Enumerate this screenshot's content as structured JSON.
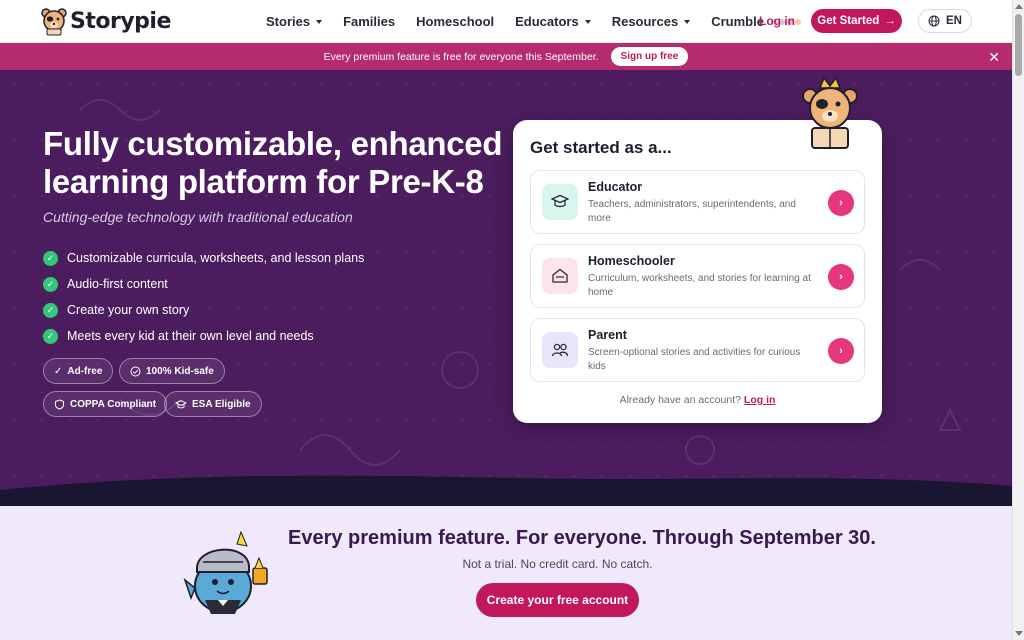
{
  "header": {
    "logo_text": "Storypie",
    "nav": [
      {
        "label": "Stories",
        "dropdown": true
      },
      {
        "label": "Families",
        "dropdown": false
      },
      {
        "label": "Homeschool",
        "dropdown": false
      },
      {
        "label": "Educators",
        "dropdown": true
      },
      {
        "label": "Resources",
        "dropdown": true
      },
      {
        "label": "Crumble",
        "dropdown": false
      }
    ],
    "login_label": "Log in",
    "get_started_label": "Get Started",
    "language_label": "EN"
  },
  "banner": {
    "text": "Every premium feature is free for everyone this September.",
    "button_label": "Sign up free",
    "close_icon": "close-icon"
  },
  "hero": {
    "title": "Fully customizable, enhanced learning platform for Pre-K-8",
    "tagline": "Cutting-edge technology with traditional education",
    "features": [
      "Customizable curricula, worksheets, and lesson plans",
      "Audio-first content",
      "Create your own story",
      "Meets every kid at their own level and needs"
    ],
    "badges": [
      "Ad-free",
      "100% Kid-safe",
      "COPPA Compliant",
      "ESA Eligible"
    ]
  },
  "card": {
    "title": "Get started as a...",
    "options": [
      {
        "title": "Educator",
        "description": "Teachers, administrators, superintendents, and more",
        "icon": "graduation-cap-icon"
      },
      {
        "title": "Homeschooler",
        "description": "Curriculum, worksheets, and stories for learning at home",
        "icon": "house-icon"
      },
      {
        "title": "Parent",
        "description": "Screen-optional stories and activities for curious kids",
        "icon": "people-icon"
      }
    ],
    "account_prompt": "Already have an account?",
    "login_label": "Log in"
  },
  "promo": {
    "headline": "Every premium feature. For everyone. Through September 30.",
    "subtext": "Not a trial. No credit card. No catch.",
    "button_label": "Create your free account"
  },
  "colors": {
    "brand": "#c2185b",
    "hero_bg": "#4b1d5e",
    "banner_bg": "#b52b6f",
    "check_green": "#34c77b",
    "promo_bg": "#efe9fb"
  }
}
